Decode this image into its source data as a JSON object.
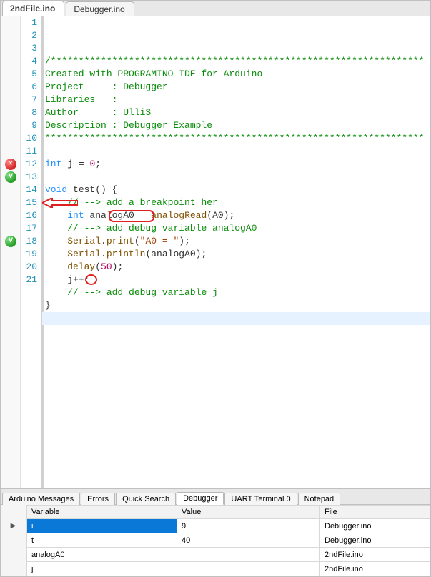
{
  "tabs": {
    "top": [
      "2ndFile.ino",
      "Debugger.ino"
    ],
    "active": 0
  },
  "code": {
    "lines": [
      "/*******************************************************************",
      "Created with PROGRAMINO IDE for Arduino",
      "Project     : Debugger",
      "Libraries   :",
      "Author      : UlliS",
      "Description : Debugger Example",
      "********************************************************************",
      "",
      "int j = 0;",
      "",
      "void test() {",
      "    // --> add a breakpoint her",
      "    int analogA0 = analogRead(A0);",
      "    // --> add debug variable analogA0",
      "    Serial.print(\"A0 = \");",
      "    Serial.println(analogA0);",
      "    delay(50);",
      "    j++;",
      "    // --> add debug variable j",
      "}",
      ""
    ],
    "markers": [
      {
        "line": 12,
        "kind": "red",
        "glyph": "✕"
      },
      {
        "line": 13,
        "kind": "green",
        "glyph": "V"
      },
      {
        "line": 18,
        "kind": "green",
        "glyph": "V"
      }
    ],
    "cursor_line": 21
  },
  "bottom_tabs": {
    "items": [
      "Arduino Messages",
      "Errors",
      "Quick Search",
      "Debugger",
      "UART Terminal 0",
      "Notepad"
    ],
    "active": 3
  },
  "debugger": {
    "columns": [
      "Variable",
      "Value",
      "File"
    ],
    "rows": [
      {
        "variable": "i",
        "value": "9",
        "file": "Debugger.ino",
        "selected": true,
        "marker": "▶"
      },
      {
        "variable": "t",
        "value": "40",
        "file": "Debugger.ino"
      },
      {
        "variable": "analogA0",
        "value": "",
        "file": "2ndFile.ino"
      },
      {
        "variable": "j",
        "value": "",
        "file": "2ndFile.ino"
      }
    ]
  }
}
